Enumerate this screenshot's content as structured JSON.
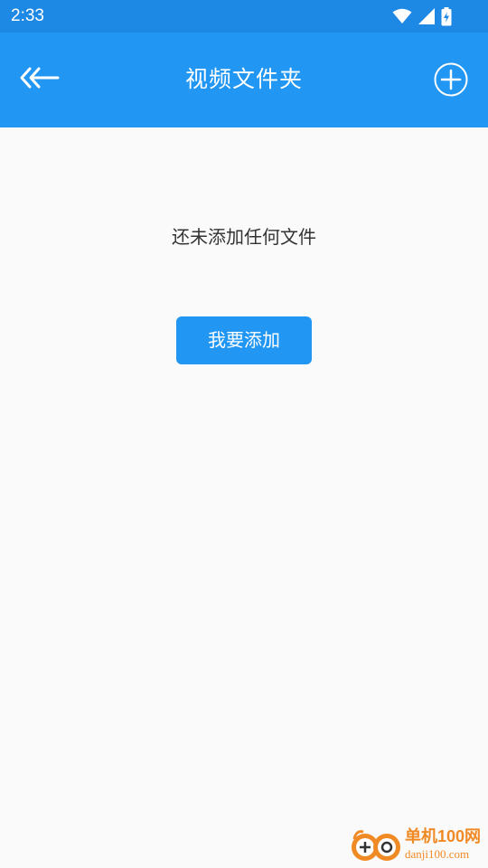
{
  "status_bar": {
    "time": "2:33",
    "icons": [
      "wifi-icon",
      "signal-icon",
      "battery-charging-icon"
    ]
  },
  "app_bar": {
    "title": "视频文件夹",
    "back_icon": "back-arrow-icon",
    "add_icon": "add-circle-icon"
  },
  "empty_state": {
    "message": "还未添加任何文件",
    "button_label": "我要添加"
  },
  "watermark": {
    "name": "单机100网",
    "domain": "danji100.com"
  },
  "colors": {
    "status_bar": "#1e88e5",
    "app_bar": "#2196f3",
    "button": "#2196f3",
    "background": "#fafafa",
    "text": "#333333",
    "watermark": "#f08a24"
  }
}
